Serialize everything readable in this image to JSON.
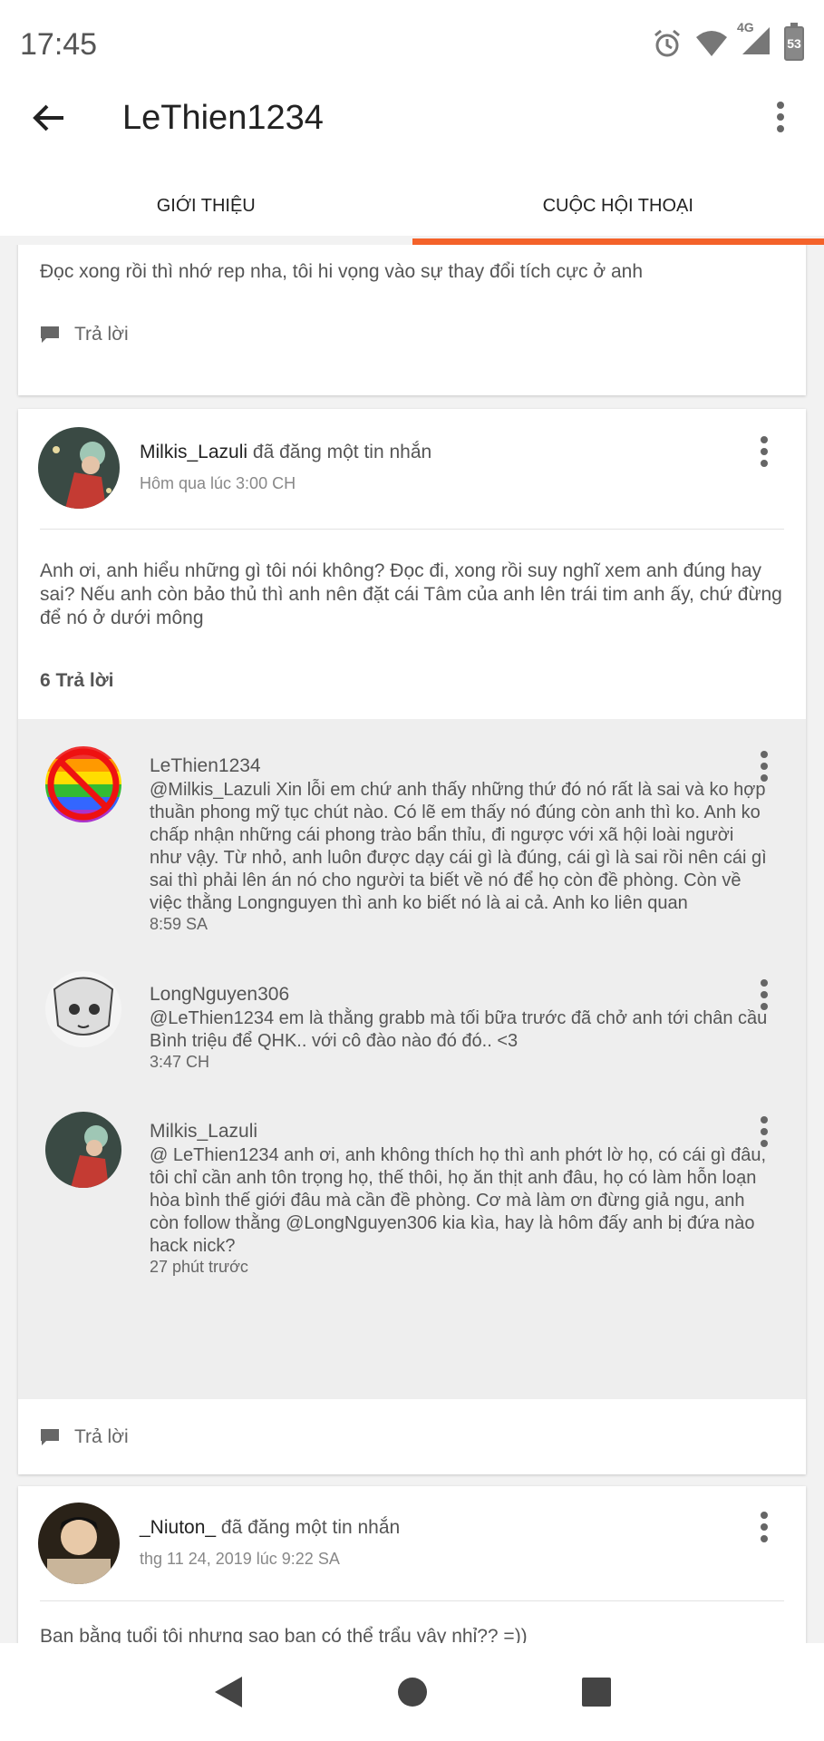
{
  "status": {
    "time": "17:45",
    "network": "4G",
    "battery": "53"
  },
  "app": {
    "title": "LeThien1234"
  },
  "tabs": [
    {
      "label": "GIỚI THIỆU",
      "active": false
    },
    {
      "label": "CUỘC HỘI THOẠI",
      "active": true
    }
  ],
  "accent_color": "#f4622a",
  "card1": {
    "text": "Đọc xong rồi thì nhớ rep nha, tôi hi vọng vào sự thay đổi tích cực ở anh",
    "reply_label": "Trả lời"
  },
  "card2": {
    "author": "Milkis_Lazuli",
    "action": "đã đăng một tin nhắn",
    "time": "Hôm qua lúc 3:00 CH",
    "text": "Anh ơi, anh hiểu những gì tôi nói không? Đọc đi, xong rồi suy nghĩ xem anh đúng hay sai? Nếu anh còn bảo thủ thì anh nên đặt cái Tâm của anh lên trái tim anh ấy, chứ đừng để nó ở dưới mông",
    "replies_count": "6 Trả lời",
    "replies": [
      {
        "name": "LeThien1234",
        "text": "@Milkis_Lazuli Xin lỗi em chứ anh thấy những thứ đó nó rất là sai và ko hợp thuần phong mỹ tục chút nào. Có lẽ em thấy nó đúng còn anh thì ko. Anh ko chấp nhận những cái phong trào bẩn thỉu, đi ngược với xã hội loài người như vậy. Từ nhỏ, anh luôn được dạy cái gì là đúng, cái gì là sai rồi nên cái gì sai thì phải lên án nó cho người ta biết về nó để họ còn đề phòng. Còn về việc thằng Longnguyen thì anh ko biết nó là ai cả. Anh ko liên quan",
        "time": "8:59 SA"
      },
      {
        "name": "LongNguyen306",
        "text": "@LeThien1234 em là thằng grabb mà tối bữa trước đã chở anh tới chân cầu Bình triệu để QHK.. với cô đào nào đó đó.. <3",
        "time": "3:47 CH"
      },
      {
        "name": "Milkis_Lazuli",
        "text": "@ LeThien1234  anh ơi, anh không thích họ thì anh phớt lờ họ, có cái gì đâu, tôi chỉ cần anh tôn trọng họ, thế thôi, họ ăn thịt anh đâu, họ có làm hỗn loạn hòa bình thế giới đâu mà cần đề phòng. Cơ mà làm ơn đừng giả ngu, anh còn follow thằng @LongNguyen306 kia kìa, hay là hôm đấy anh bị đứa nào hack nick?",
        "time": "27 phút trước"
      }
    ],
    "reply_label": "Trả lời"
  },
  "card3": {
    "author": "_Niuton_",
    "action": "đã đăng một tin nhắn",
    "time": "thg 11 24, 2019 lúc 9:22 SA",
    "text": "Bạn bằng tuổi tôi nhưng sao bạn có thể trẩu vậy nhỉ?? =))"
  }
}
